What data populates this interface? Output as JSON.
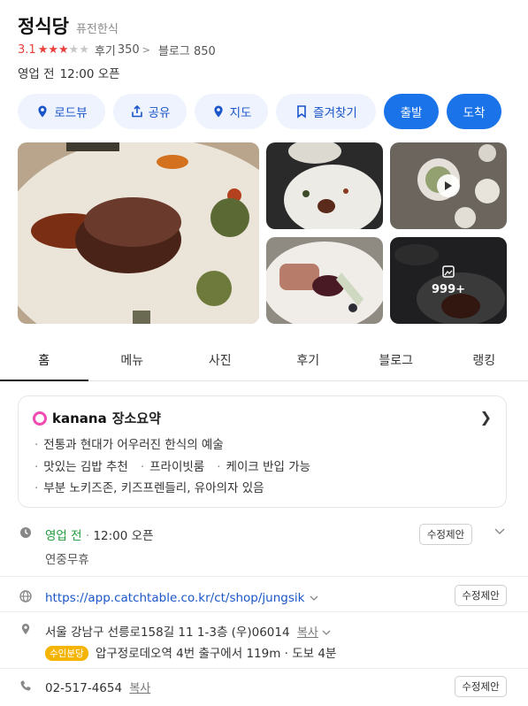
{
  "place": {
    "name": "정식당",
    "category": "퓨전한식",
    "rating": "3.1",
    "rating_value": 3.1,
    "reviews_label": "후기",
    "reviews_count": "350",
    "blog_label": "블로그",
    "blog_count": "850",
    "status": "영업 전",
    "open_time": "12:00 오픈"
  },
  "actions": {
    "roadview": "로드뷰",
    "share": "공유",
    "map": "지도",
    "save": "즐겨찾기",
    "depart": "출발",
    "arrive": "도착"
  },
  "photos": {
    "more_count": "999+"
  },
  "tabs": [
    "홈",
    "메뉴",
    "사진",
    "후기",
    "블로그",
    "랭킹"
  ],
  "summary": {
    "brand": "kanana",
    "title": "장소요약",
    "line1": "전통과 현대가 어우러진 한식의 예술",
    "line2a": "맛있는 김밥 추천",
    "line2b": "프라이빗룸",
    "line2c": "케이크 반입 가능",
    "line3": "부분 노키즈존, 키즈프렌들리, 유아의자 있음"
  },
  "info": {
    "hours_status": "영업 전",
    "hours_time": "12:00 오픈",
    "holiday": "연중무휴",
    "suggest": "수정제안",
    "website": "https://app.catchtable.co.kr/ct/shop/jungsik",
    "address": "서울 강남구 선릉로158길 11 1-3층 (우)06014",
    "copy": "복사",
    "exit_badge": "수인분당",
    "directions": "압구정로데오역 4번 출구에서 119m · 도보 4분",
    "phone": "02-517-4654"
  },
  "colors": {
    "accent": "#1a73e8",
    "rating": "#e8403c",
    "open": "#1e9a3a",
    "kanana": "#f04bb1"
  }
}
